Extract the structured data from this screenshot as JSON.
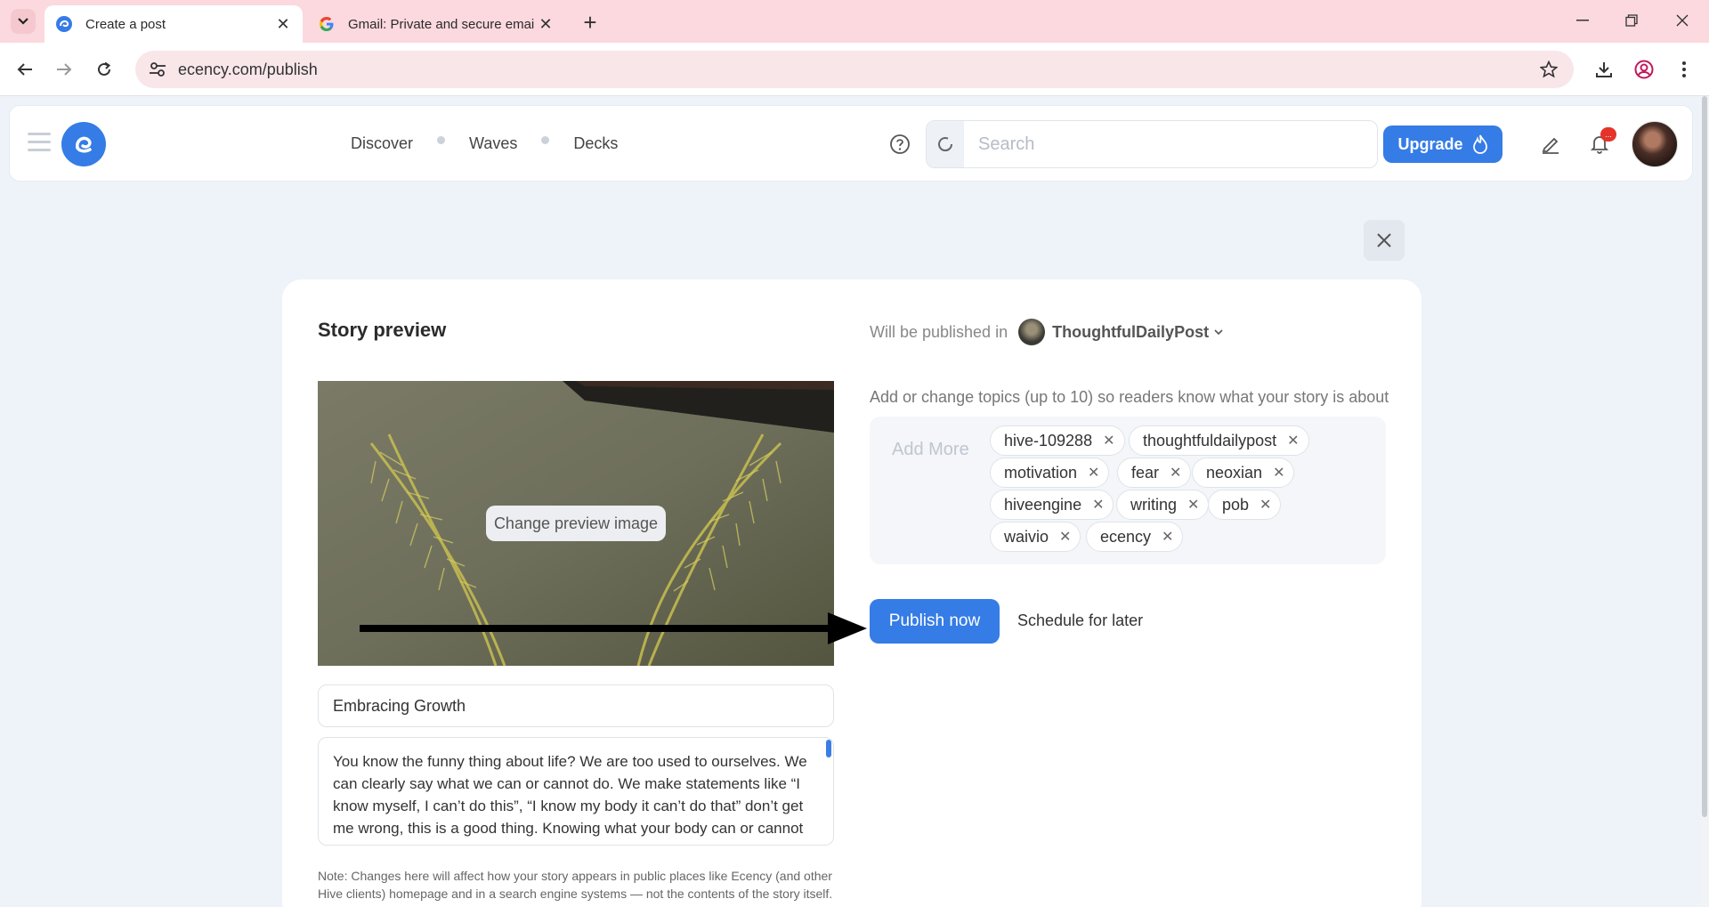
{
  "browser": {
    "tabs": [
      {
        "title": "Create a post",
        "icon": "ecency-favicon",
        "active": true
      },
      {
        "title": "Gmail: Private and secure email",
        "icon": "google-favicon",
        "active": false
      }
    ],
    "url": "ecency.com/publish"
  },
  "header": {
    "nav": [
      "Discover",
      "Waves",
      "Decks"
    ],
    "search_placeholder": "Search",
    "upgrade_label": "Upgrade",
    "notification_badge": "..."
  },
  "story_preview": {
    "heading": "Story preview",
    "change_image_label": "Change preview image",
    "title_value": "Embracing Growth",
    "body_text": "You know the funny thing about life? We are too used to ourselves. We can clearly say what we can or cannot do. We make statements like “I know myself, I can’t do this”, “I know my body it can’t do that” don’t get me wrong, this is a good thing. Knowing what your body can or cannot do is great but it can limit you. This “I know myself” ...",
    "note": "Note: Changes here will affect how your story appears in public places like Ecency (and other Hive clients) homepage and in a search engine systems — not the contents of the story itself."
  },
  "publish": {
    "will_be_published_label": "Will be published in",
    "community_name": "ThoughtfulDailyPost",
    "topics_hint": "Add or change topics (up to 10) so readers know what your story is about",
    "add_more_placeholder": "Add More",
    "tags": [
      "hive-109288",
      "thoughtfuldailypost",
      "motivation",
      "fear",
      "neoxian",
      "hiveengine",
      "writing",
      "pob",
      "waivio",
      "ecency"
    ],
    "publish_now_label": "Publish now",
    "schedule_label": "Schedule for later"
  },
  "colors": {
    "accent": "#357ce6",
    "tabbar": "#fbd9de",
    "page_bg": "#eef3f9"
  }
}
